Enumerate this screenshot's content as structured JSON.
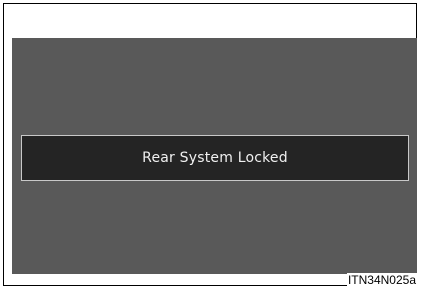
{
  "screen": {
    "message": "Rear System Locked"
  },
  "figure": {
    "code": "ITN34N025a"
  },
  "colors": {
    "screen_background": "#595959",
    "message_background": "#242424",
    "message_border": "#c8c8c8",
    "message_text": "#f0f0f0"
  }
}
